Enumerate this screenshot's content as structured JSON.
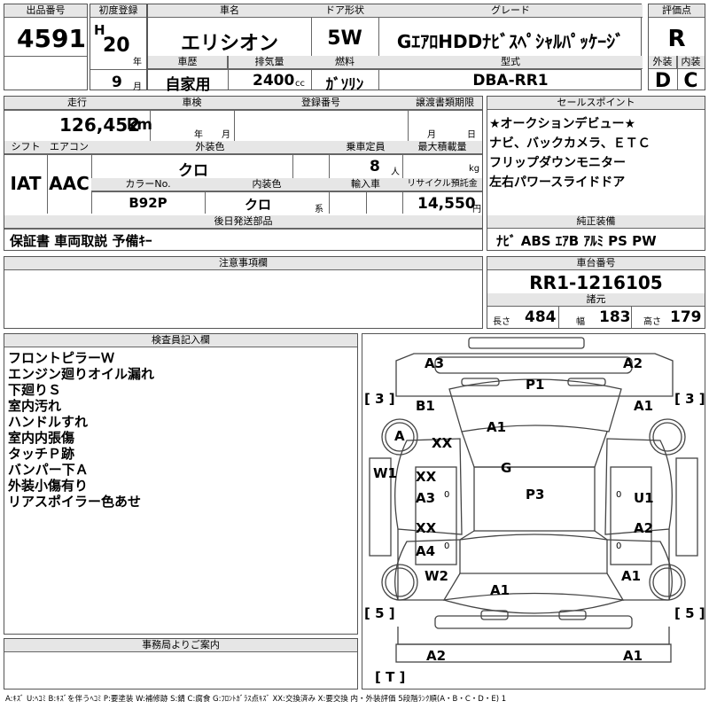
{
  "top": {
    "lot_no_label": "出品番号",
    "lot_no": "4591",
    "first_reg_label": "初度登録",
    "era": "H",
    "year": "20",
    "year_unit": "年",
    "month": "9",
    "month_unit": "月",
    "car_name_label": "車名",
    "car_name": "エリシオン",
    "door_label": "ドア形状",
    "door": "5W",
    "grade_label": "グレード",
    "grade": "GｴｱﾛHDDﾅﾋﾞｽﾍﾟｼｬﾙﾊﾟｯｹｰｼﾞ",
    "score_label": "評価点",
    "score": "R",
    "history_label": "車歴",
    "history": "自家用",
    "displacement_label": "排気量",
    "displacement": "2400",
    "displacement_unit": "cc",
    "fuel_label": "燃料",
    "fuel": "ｶﾞｿﾘﾝ",
    "model_label": "型式",
    "model": "DBA-RR1",
    "exterior_label": "外装",
    "exterior": "D",
    "interior_label": "内装",
    "interior": "C"
  },
  "mid": {
    "mileage_label": "走行",
    "mileage": "126,452",
    "mileage_unit": "km",
    "inspection_label": "車検",
    "year_unit": "年",
    "month_unit": "月",
    "plate_label": "登録番号",
    "transfer_label": "譲渡書類期限",
    "t_month": "月",
    "t_day": "日",
    "shift_label": "シフト",
    "shift": "IAT",
    "ac_label": "エアコン",
    "ac": "AAC",
    "color_label": "外装色",
    "color": "クロ",
    "seats_label": "乗車定員",
    "seats": "8",
    "seats_unit": "人",
    "load_label": "最大積載量",
    "load_unit": "kg",
    "color_no_label": "カラーNo.",
    "color_no": "B92P",
    "int_color_label": "内装色",
    "int_color": "クロ",
    "int_suffix": "系",
    "import_label": "輸入車",
    "recycle_label": "リサイクル預託金",
    "recycle": "14,550",
    "recycle_unit": "円",
    "post_label": "後日発送部品",
    "post": "保証書 車両取説 予備ｷｰ"
  },
  "sales": {
    "label": "セールスポイント",
    "lines": [
      "★オークションデビュー★",
      "ナビ、バックカメラ、ＥＴＣ",
      "フリップダウンモニター",
      "左右パワースライドドア"
    ]
  },
  "equip": {
    "label": "純正装備",
    "value": "ﾅﾋﾞ ABS ｴｱB ｱﾙﾐ PS PW"
  },
  "notes": {
    "label": "注意事項欄"
  },
  "chassis": {
    "label": "車台番号",
    "value": "RR1-1216105",
    "spec_label": "諸元",
    "len_label": "長さ",
    "len": "484",
    "wid_label": "幅",
    "wid": "183",
    "hgt_label": "高さ",
    "hgt": "179"
  },
  "inspector": {
    "label": "検査員記入欄",
    "lines": [
      "フロントピラーＷ",
      "エンジン廻りオイル漏れ",
      "下廻りＳ",
      "室内汚れ",
      "ハンドルすれ",
      "室内内張傷",
      "タッチＰ跡",
      "バンパー下Ａ",
      "外装小傷有り",
      "リアスポイラー色あせ"
    ]
  },
  "office": {
    "label": "事務局よりご案内"
  },
  "diagram": {
    "marks": [
      "A3",
      "A2",
      "P1",
      "B1",
      "A1",
      "A1",
      "A",
      "XX",
      "A1",
      "G",
      "W1",
      "XX",
      "A3",
      "P3",
      "U1",
      "XX",
      "A4",
      "A2",
      "W2",
      "A1",
      "A1",
      "A1",
      "A2",
      "A1"
    ],
    "corner_left_top": "[ 3 ]",
    "corner_right_top": "[ 3 ]",
    "corner_left_bot": "[ 5 ]",
    "corner_right_bot": "[ 5 ]",
    "tail": "[ T ]",
    "zero": "0"
  },
  "legend": "A:ｷｽﾞ U:ﾍｺﾐ B:ｷｽﾞを伴うﾍｺﾐ P:要塗装 W:補修跡 S:錆 C:腐食 G:ﾌﾛﾝﾄｶﾞﾗｽ点ｷｽﾞ XX:交換済み X:要交換 内・外装評価 5段階ﾗﾝｸ順(A・B・C・D・E) 1"
}
